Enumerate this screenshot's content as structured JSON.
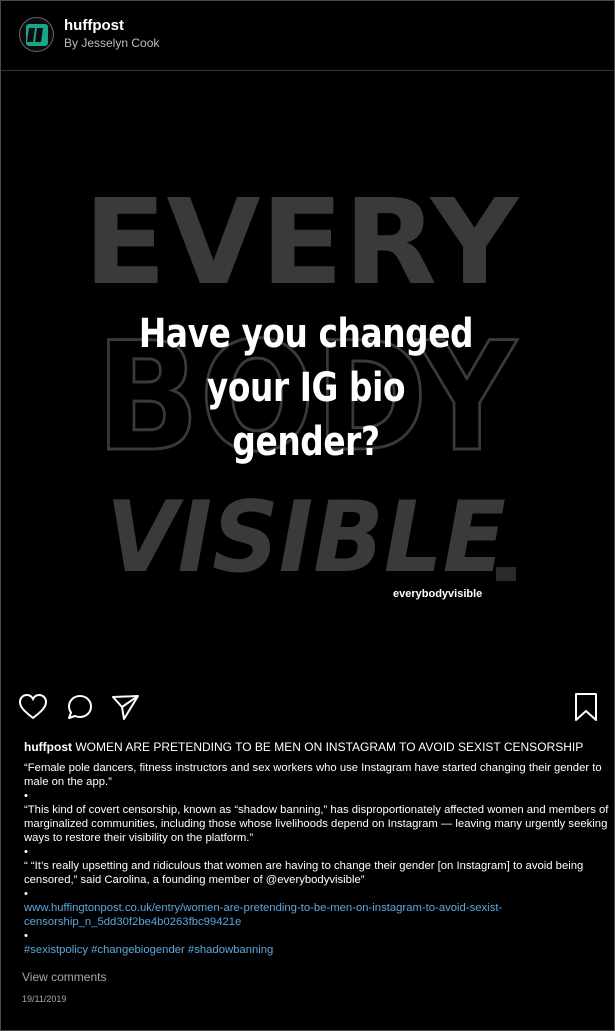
{
  "header": {
    "username": "huffpost",
    "byline": "By Jesselyn Cook",
    "logo_icon": "huffpost-logo-icon"
  },
  "post_image": {
    "bg_word_top": "EVERY",
    "bg_word_middle": "BODY",
    "bg_word_bottom": "VISIBLE",
    "headline_line1": "Have you changed",
    "headline_line2": "your IG bio gender?",
    "brand_tag": "everybodyvisible"
  },
  "actions": {
    "like_icon": "heart-icon",
    "comment_icon": "comment-icon",
    "share_icon": "send-icon",
    "save_icon": "bookmark-icon"
  },
  "caption": {
    "username": "huffpost",
    "title": "WOMEN ARE PRETENDING TO BE MEN ON INSTAGRAM TO AVOID SEXIST CENSORSHIP",
    "para1": "“Female pole dancers, fitness instructors and sex workers who use Instagram have started changing their gender to male on the app.”",
    "para2": "“This kind of covert censorship, known as “shadow banning,” has disproportionately affected women and members of marginalized communities, including those whose livelihoods depend on Instagram — leaving many urgently seeking ways to restore their visibility on the platform.”",
    "para3": "“ “It’s really upsetting and ridiculous that women are having to change their gender [on Instagram] to avoid being censored,” said Carolina, a founding member of @everybodyvisible”",
    "link": "www.huffingtonpost.co.uk/entry/women-are-pretending-to-be-men-on-instagram-to-avoid-sexist-censorship_n_5dd30f2be4b0263fbc99421e",
    "hashtags": "#sexistpolicy #changebiogender #shadowbanning",
    "bullet": "•"
  },
  "footer": {
    "view_comments": "View  comments",
    "date": "19/11/2019"
  },
  "colors": {
    "background": "#000000",
    "link": "#5ba8e0",
    "logo_green": "#18a589",
    "bg_text": "#3a3a3a"
  }
}
